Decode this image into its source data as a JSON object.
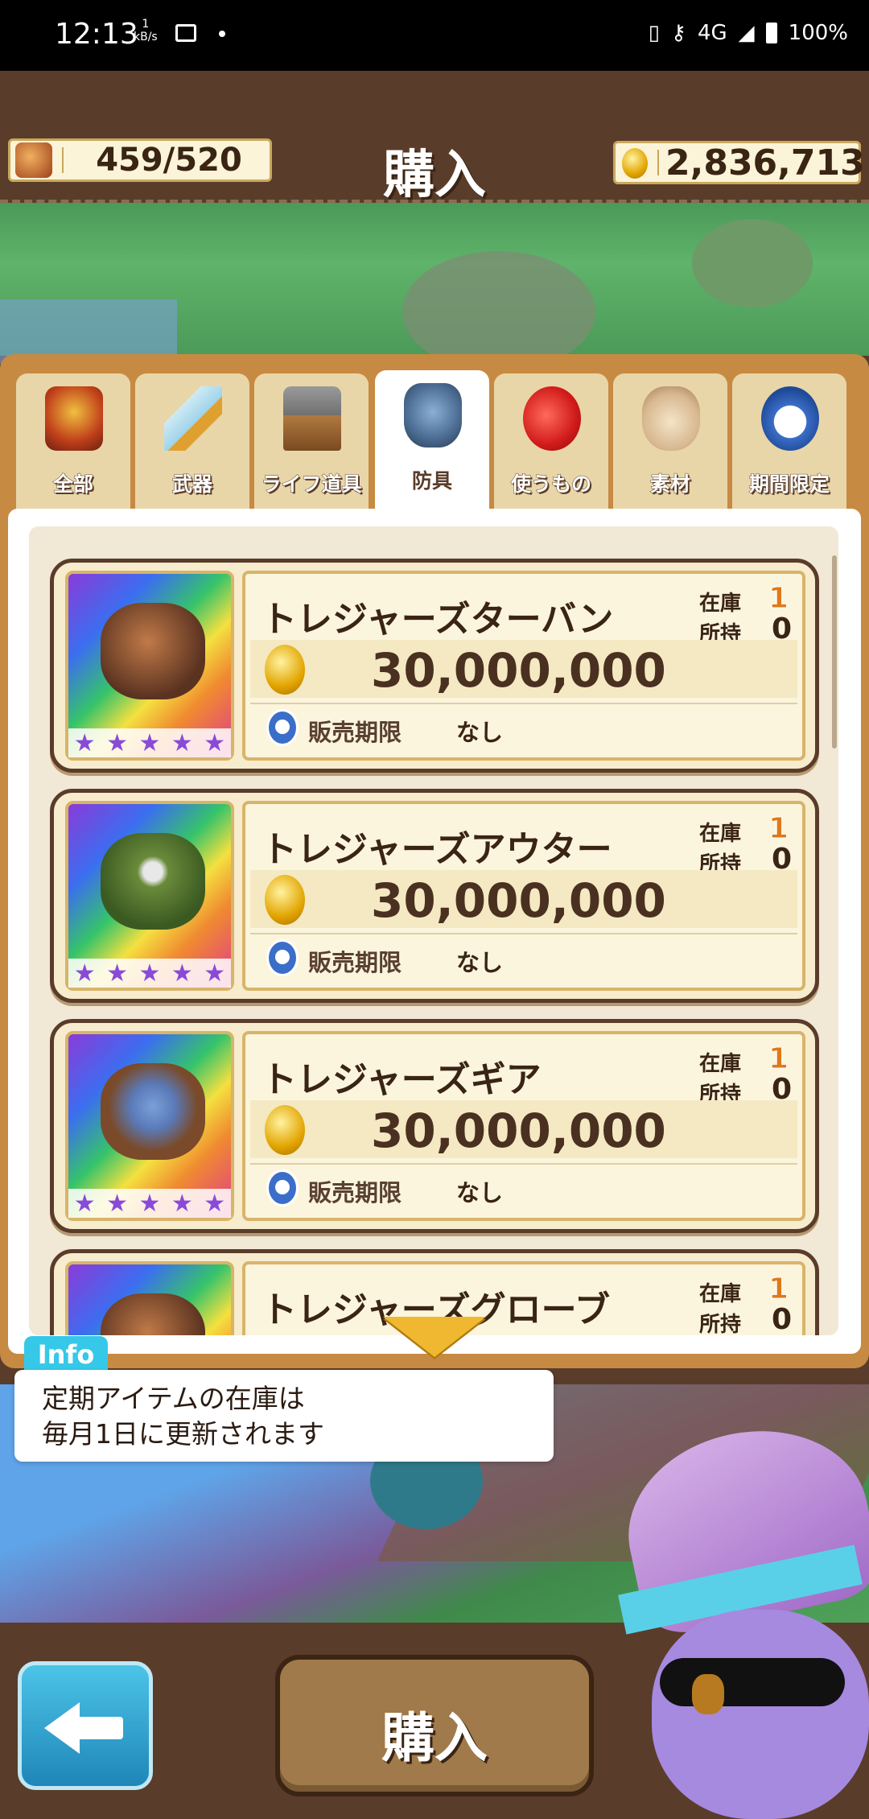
{
  "status_bar": {
    "time": "12:13",
    "speed": "1",
    "speed_unit": "kB/s",
    "network": "4G",
    "battery": "100%"
  },
  "header": {
    "bag_count": "459/520",
    "title": "購入",
    "coins": "2,836,713"
  },
  "tabs": [
    {
      "label": "全部",
      "icon": "treasure-chest-icon",
      "active": false
    },
    {
      "label": "武器",
      "icon": "sword-icon",
      "active": false
    },
    {
      "label": "ライフ道具",
      "icon": "hammer-icon",
      "active": false
    },
    {
      "label": "防具",
      "icon": "armor-icon",
      "active": true
    },
    {
      "label": "使うもの",
      "icon": "apple-icon",
      "active": false
    },
    {
      "label": "素材",
      "icon": "bag-icon",
      "active": false
    },
    {
      "label": "期間限定",
      "icon": "stopwatch-icon",
      "active": false
    }
  ],
  "items": [
    {
      "name": "トレジャーズターバン",
      "stock_label": "在庫",
      "stock": "1",
      "owned_label": "所持",
      "owned": "0",
      "price": "30,000,000",
      "limit_label": "販売期限",
      "limit": "なし",
      "rarity": 5
    },
    {
      "name": "トレジャーズアウター",
      "stock_label": "在庫",
      "stock": "1",
      "owned_label": "所持",
      "owned": "0",
      "price": "30,000,000",
      "limit_label": "販売期限",
      "limit": "なし",
      "rarity": 5
    },
    {
      "name": "トレジャーズギア",
      "stock_label": "在庫",
      "stock": "1",
      "owned_label": "所持",
      "owned": "0",
      "price": "30,000,000",
      "limit_label": "販売期限",
      "limit": "なし",
      "rarity": 5
    },
    {
      "name": "トレジャーズグローブ",
      "stock_label": "在庫",
      "stock": "1",
      "owned_label": "所持",
      "owned": "0"
    }
  ],
  "info": {
    "tag": "Info",
    "text": "定期アイテムの在庫は\n毎月1日に更新されます"
  },
  "footer": {
    "buy_label": "購入"
  },
  "colors": {
    "header_bg": "#5a3c2a",
    "panel_bg": "#c78a42",
    "accent_orange": "#e07818",
    "info_tag": "#36c8e8"
  }
}
